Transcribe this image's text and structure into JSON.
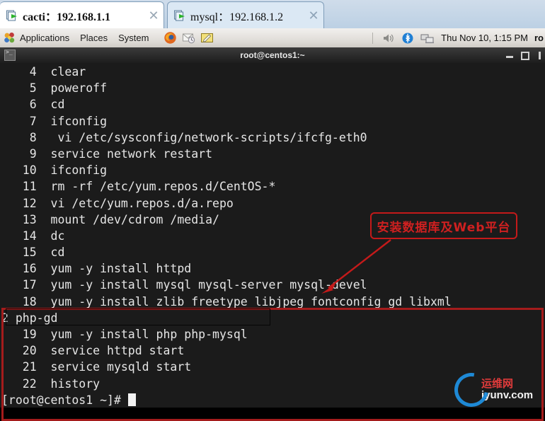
{
  "browser": {
    "tabs": [
      {
        "icon": "page-arrow-icon",
        "label": "cacti：192.168.1.1",
        "close": "✕",
        "active": true
      },
      {
        "icon": "page-arrow-icon",
        "label": "mysql：192.168.1.2",
        "close": "✕",
        "active": false
      }
    ]
  },
  "panel": {
    "menus": [
      "Applications",
      "Places",
      "System"
    ],
    "launchers": [
      "firefox-icon",
      "evolution-mail-icon",
      "text-editor-icon"
    ],
    "tray_icons": [
      "volume-icon",
      "bluetooth-icon",
      "network-icon"
    ],
    "clock": "Thu Nov 10,  1:15 PM",
    "user": "ro"
  },
  "window": {
    "title": "root@centos1:~",
    "icon": "terminal-icon",
    "buttons": [
      "minimize",
      "maximize",
      "close"
    ]
  },
  "terminal": {
    "lines": [
      {
        "num": "    4",
        "cmd": "  clear"
      },
      {
        "num": "    5",
        "cmd": "  poweroff"
      },
      {
        "num": "    6",
        "cmd": "  cd"
      },
      {
        "num": "    7",
        "cmd": "  ifconfig"
      },
      {
        "num": "    8",
        "cmd": "   vi /etc/sysconfig/network-scripts/ifcfg-eth0"
      },
      {
        "num": "    9",
        "cmd": "  service network restart"
      },
      {
        "num": "   10",
        "cmd": "  ifconfig"
      },
      {
        "num": "   11",
        "cmd": "  rm -rf /etc/yum.repos.d/CentOS-*"
      },
      {
        "num": "   12",
        "cmd": "  vi /etc/yum.repos.d/a.repo"
      },
      {
        "num": "   13",
        "cmd": "  mount /dev/cdrom /media/"
      },
      {
        "num": "   14",
        "cmd": "  dc"
      },
      {
        "num": "   15",
        "cmd": "  cd"
      },
      {
        "num": "   16",
        "cmd": "  yum -y install httpd"
      },
      {
        "num": "   17",
        "cmd": "  yum -y install mysql mysql-server mysql-devel"
      },
      {
        "num": "   18",
        "cmd": "  yum -y install zlib freetype libjpeg fontconfig gd libxml"
      },
      {
        "num": "",
        "cmd": "2 php-gd"
      },
      {
        "num": "   19",
        "cmd": "  yum -y install php php-mysql"
      },
      {
        "num": "   20",
        "cmd": "  service httpd start"
      },
      {
        "num": "   21",
        "cmd": "  service mysqld start"
      },
      {
        "num": "   22",
        "cmd": "  history"
      }
    ],
    "prompt": "[root@centos1 ~]# "
  },
  "annotations": {
    "note_text": "安装数据库及Web平台",
    "note_color": "#cf2020",
    "highlight_color": "#a51c1c",
    "arrow": "down-left-arrow"
  },
  "watermark": {
    "cn": "运维网",
    "en": "iyunv.com",
    "ring_color": "#1f8fe0"
  }
}
